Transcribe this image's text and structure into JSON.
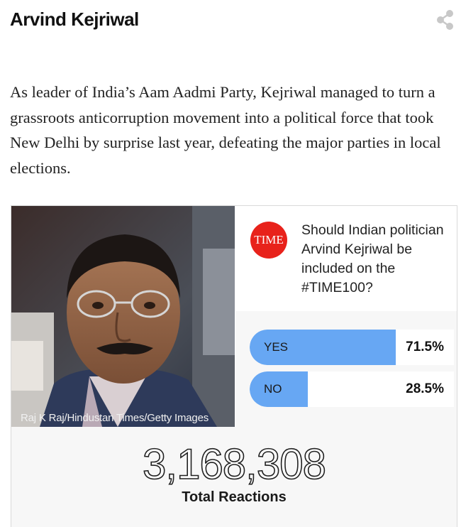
{
  "header": {
    "title": "Arvind Kejriwal",
    "share_icon": "share-icon"
  },
  "description": "As leader of India’s Aam Aadmi Party, Kejriwal managed to turn a grassroots anticorruption movement into a political force that took New Delhi by surprise last year, defeating the major parties in local elections.",
  "card": {
    "photo_credit": "Raj K Raj/Hindustan Times/Getty Images",
    "logo_text": "TIME",
    "logo_color": "#e8221b",
    "question": "Should Indian politician Arvind Kejriwal be included on the #TIME100?",
    "bar_color": "#67a7f3",
    "options": [
      {
        "label": "YES",
        "percent_text": "71.5%",
        "percent": 71.5
      },
      {
        "label": "NO",
        "percent_text": "28.5%",
        "percent": 28.5
      }
    ],
    "total_count": "3,168,308",
    "total_label": "Total Reactions"
  }
}
